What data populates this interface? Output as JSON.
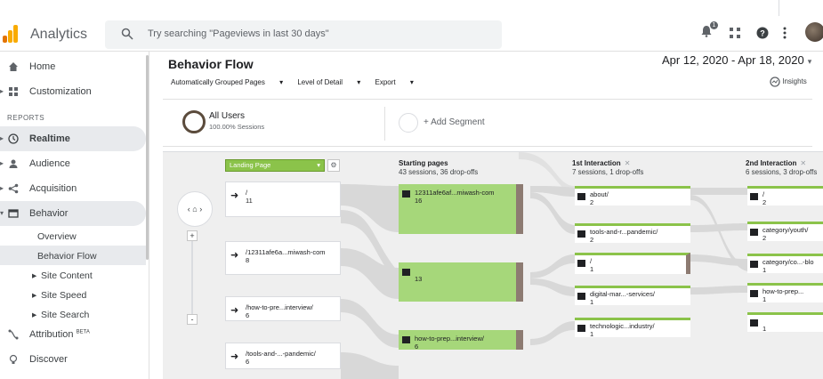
{
  "app": {
    "name": "Analytics"
  },
  "search": {
    "placeholder": "Try searching \"Pageviews in last 30 days\""
  },
  "header_icons": {
    "notifications": "bell-icon",
    "notification_count": "1",
    "apps": "apps-grid-icon",
    "help": "help-icon",
    "more": "more-vert-icon"
  },
  "sidebar": {
    "items": [
      {
        "label": "Home",
        "icon": "home-icon"
      },
      {
        "label": "Customization",
        "icon": "customization-icon"
      }
    ],
    "reports_heading": "REPORTS",
    "reports": [
      {
        "label": "Realtime",
        "icon": "clock-icon"
      },
      {
        "label": "Audience",
        "icon": "person-icon"
      },
      {
        "label": "Acquisition",
        "icon": "acquisition-icon"
      },
      {
        "label": "Behavior",
        "icon": "behavior-icon"
      }
    ],
    "behavior_sub": [
      "Overview",
      "Behavior Flow",
      "Site Content",
      "Site Speed",
      "Site Search"
    ],
    "bottom": [
      {
        "label": "Attribution",
        "sup": "BETA",
        "icon": "attribution-icon"
      },
      {
        "label": "Discover",
        "icon": "lightbulb-icon"
      }
    ]
  },
  "page": {
    "title": "Behavior Flow",
    "date_range": "Apr 12, 2020 - Apr 18, 2020",
    "toolbar": [
      "Automatically Grouped Pages",
      "Level of Detail",
      "Export"
    ],
    "insights": "Insights"
  },
  "segment": {
    "name": "All Users",
    "sub": "100.00% Sessions",
    "add": "+ Add Segment"
  },
  "flow": {
    "dimension": "Landing Page",
    "columns": [
      {
        "title": "Starting pages",
        "sub": "43 sessions, 36 drop-offs"
      },
      {
        "title": "1st Interaction",
        "sub": "7 sessions, 1 drop-offs"
      },
      {
        "title": "2nd Interaction",
        "sub": "6 sessions, 3 drop-offs"
      }
    ],
    "landing": [
      {
        "label": "/",
        "count": "11"
      },
      {
        "label": "/12311afe6a...miwash-com",
        "count": "8"
      },
      {
        "label": "/how-to-pre...interview/",
        "count": "6"
      },
      {
        "label": "/tools-and-...-pandemic/",
        "count": "6"
      }
    ],
    "starting": [
      {
        "label": "12311afe6af...miwash-com",
        "count": "16"
      },
      {
        "label": "",
        "count": "13"
      },
      {
        "label": "how-to-prep...interview/",
        "count": "6"
      }
    ],
    "first": [
      {
        "label": "about/",
        "count": "2"
      },
      {
        "label": "tools-and-r...pandemic/",
        "count": "2"
      },
      {
        "label": "/",
        "count": "1"
      },
      {
        "label": "digital-mar...-services/",
        "count": "1"
      },
      {
        "label": "technologic...industry/",
        "count": "1"
      }
    ],
    "second": [
      {
        "label": "/",
        "count": "2"
      },
      {
        "label": "category/youth/",
        "count": "2"
      },
      {
        "label": "category/co...-blo",
        "count": "1"
      },
      {
        "label": "how-to-prep...",
        "count": "1"
      },
      {
        "label": "",
        "count": "1"
      }
    ]
  },
  "colors": {
    "green": "#a6d77a",
    "brown": "#8d7b72",
    "accent": "#f9ab00"
  }
}
